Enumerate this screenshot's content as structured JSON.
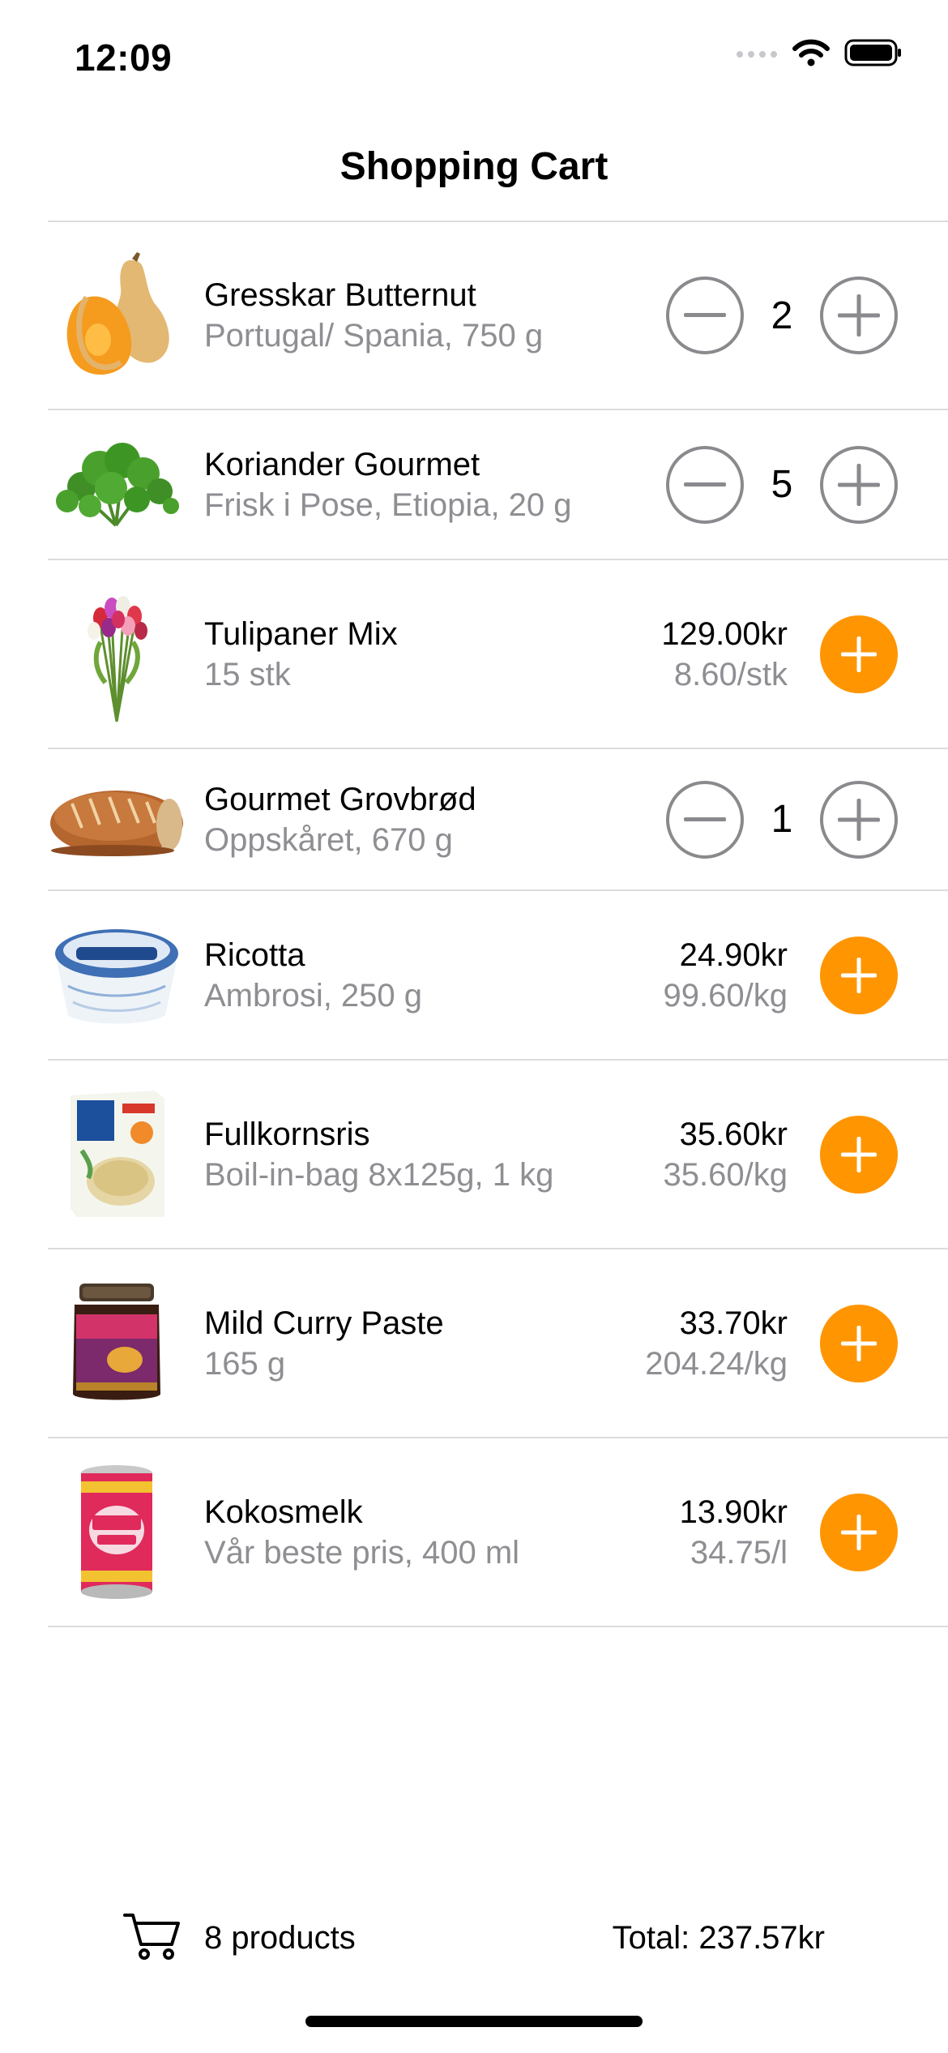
{
  "status_bar": {
    "time": "12:09"
  },
  "header": {
    "title": "Shopping Cart"
  },
  "colors": {
    "accent": "#ff9500",
    "secondary_text": "#8e8e93",
    "separator": "#dcdcdf"
  },
  "items": [
    {
      "name": "Gresskar Butternut",
      "description": "Portugal/ Spania, 750 g",
      "quantity": "2",
      "thumbnail": "butternut-squash"
    },
    {
      "name": "Koriander Gourmet",
      "description": "Frisk i Pose, Etiopia, 20 g",
      "quantity": "5",
      "thumbnail": "coriander"
    },
    {
      "name": "Tulipaner Mix",
      "description": "15 stk",
      "price": "129.00kr",
      "unit_price": "8.60/stk",
      "thumbnail": "tulips"
    },
    {
      "name": "Gourmet Grovbrød",
      "description": "Oppskåret, 670 g",
      "quantity": "1",
      "thumbnail": "bread"
    },
    {
      "name": "Ricotta",
      "description": "Ambrosi, 250 g",
      "price": "24.90kr",
      "unit_price": "99.60/kg",
      "thumbnail": "ricotta-tub"
    },
    {
      "name": "Fullkornsris",
      "description": "Boil-in-bag 8x125g, 1 kg",
      "price": "35.60kr",
      "unit_price": "35.60/kg",
      "thumbnail": "rice-box"
    },
    {
      "name": "Mild Curry Paste",
      "description": "165 g",
      "price": "33.70kr",
      "unit_price": "204.24/kg",
      "thumbnail": "curry-jar"
    },
    {
      "name": "Kokosmelk",
      "description": "Vår beste pris, 400 ml",
      "price": "13.90kr",
      "unit_price": "34.75/l",
      "thumbnail": "coconut-milk-can"
    }
  ],
  "footer": {
    "product_count": "8 products",
    "total": "Total: 237.57kr"
  },
  "icons": {
    "cart": "cart-icon",
    "minus": "minus-icon",
    "plus": "plus-icon"
  }
}
